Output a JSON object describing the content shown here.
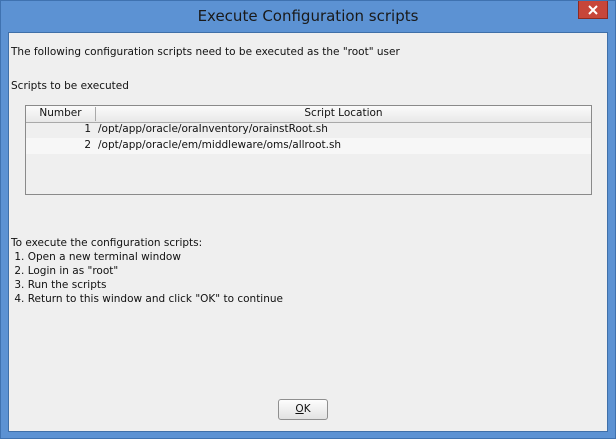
{
  "window": {
    "title": "Execute Configuration scripts",
    "close_icon": "close-icon",
    "colors": {
      "frame": "#5c92d3",
      "close": "#c7463a",
      "content": "#efefef"
    }
  },
  "intro_text": "The following configuration scripts need to be executed as the \"root\" user",
  "scripts_label": "Scripts to be executed",
  "table": {
    "headers": [
      "Number",
      "Script Location"
    ],
    "rows": [
      {
        "number": "1",
        "location": "/opt/app/oracle/oraInventory/orainstRoot.sh"
      },
      {
        "number": "2",
        "location": "/opt/app/oracle/em/middleware/oms/allroot.sh"
      }
    ]
  },
  "instructions": {
    "heading": "To execute the configuration scripts:",
    "steps": [
      " 1. Open a new terminal window",
      " 2. Login in as \"root\"",
      " 3. Run the scripts",
      " 4. Return to this window and click \"OK\" to continue"
    ]
  },
  "ok_button": {
    "mnemonic": "O",
    "rest": "K"
  }
}
